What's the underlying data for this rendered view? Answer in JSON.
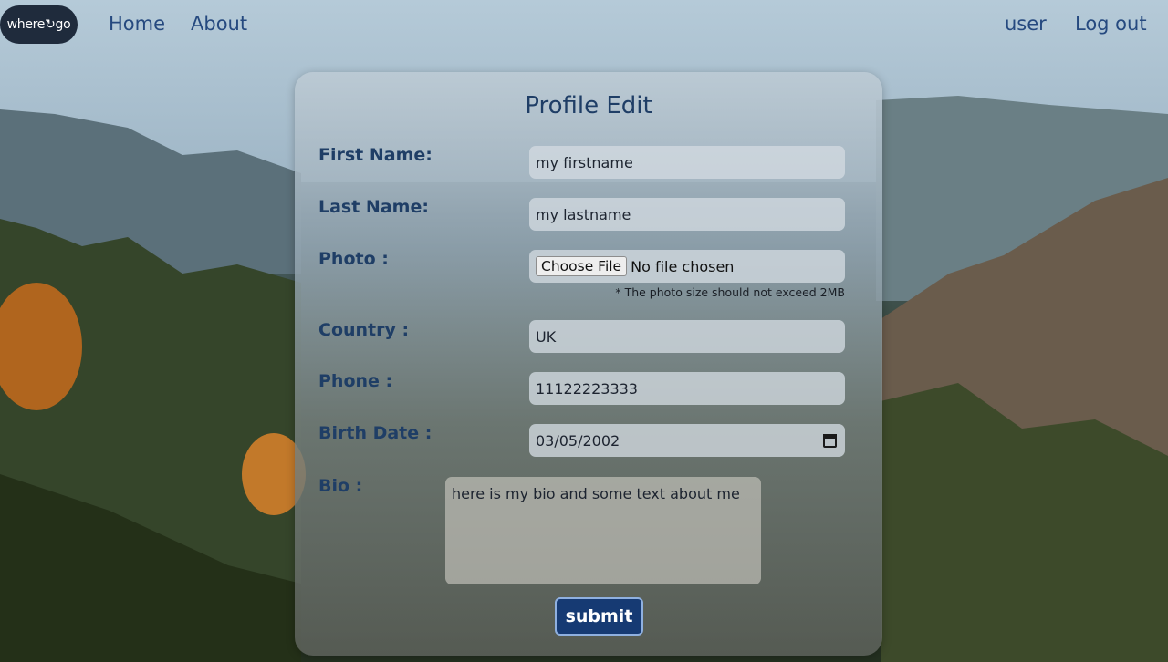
{
  "nav": {
    "logo": "where↻go",
    "home": "Home",
    "about": "About",
    "user": "user",
    "logout": "Log out"
  },
  "form": {
    "title": "Profile Edit",
    "first_name": {
      "label": "First Name:",
      "value": "my firstname"
    },
    "last_name": {
      "label": "Last Name:",
      "value": "my lastname"
    },
    "photo": {
      "label": "Photo :",
      "button": "Choose File",
      "status": "No file chosen",
      "hint": "* The photo size should not exceed 2MB"
    },
    "country": {
      "label": "Country :",
      "value": "UK"
    },
    "phone": {
      "label": "Phone :",
      "value": "11122223333"
    },
    "birth_date": {
      "label": "Birth Date :",
      "value": "03/05/2002",
      "icon": "calendar-icon"
    },
    "bio": {
      "label": "Bio :",
      "value": "here is my bio and some text about me"
    },
    "submit": "submit"
  }
}
